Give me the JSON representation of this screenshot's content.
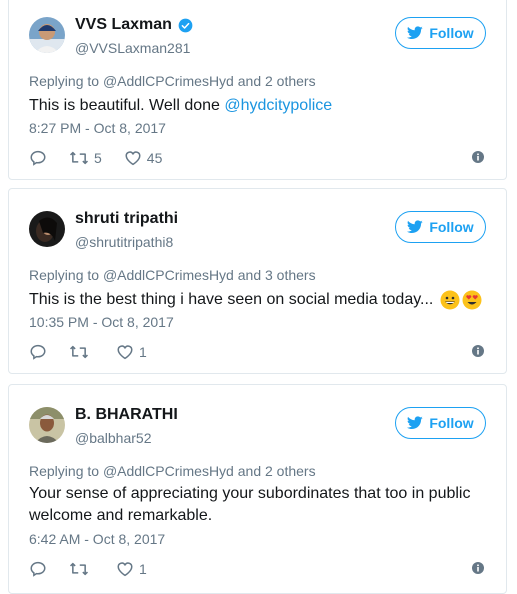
{
  "tweets": [
    {
      "display_name": "VVS Laxman",
      "verified": true,
      "handle": "@VVSLaxman281",
      "follow_label": "Follow",
      "reply_prefix": "Replying to",
      "reply_target": "@AddlCPCrimesHyd",
      "reply_suffix": "and 2 others",
      "text_before": "This is beautiful. Well done ",
      "text_link": "@hydcitypolice",
      "timestamp": "8:27 PM - Oct 8, 2017",
      "retweets": "5",
      "likes": "45"
    },
    {
      "display_name": "shruti tripathi",
      "verified": false,
      "handle": "@shrutitripathi8",
      "follow_label": "Follow",
      "reply_prefix": "Replying to",
      "reply_target": "@AddlCPCrimesHyd",
      "reply_suffix": "and 3 others",
      "text": "This is the best thing i have seen on social media today...",
      "emojis": [
        "grinning-face",
        "heart-eyes-face"
      ],
      "timestamp": "10:35 PM - Oct 8, 2017",
      "retweets": "",
      "likes": "1"
    },
    {
      "display_name": "B. BHARATHI",
      "verified": false,
      "handle": "@balbhar52",
      "follow_label": "Follow",
      "reply_prefix": "Replying to",
      "reply_target": "@AddlCPCrimesHyd",
      "reply_suffix": "and 2 others",
      "text_line1": "Your sense of appreciating your subordinates that too in public",
      "text_line2": "welcome and remarkable.",
      "timestamp": "6:42 AM - Oct 8, 2017",
      "retweets": "",
      "likes": "1"
    }
  ],
  "colors": {
    "accent": "#1da1f2",
    "link": "#1b95e0",
    "muted": "#657786",
    "text": "#14171a",
    "border": "#e1e8ed"
  }
}
